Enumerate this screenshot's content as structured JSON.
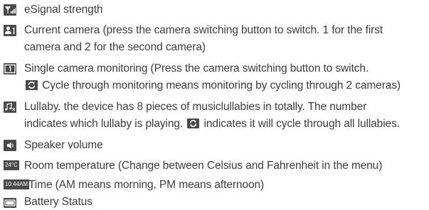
{
  "items": [
    {
      "icon": "signal-icon",
      "lines": [
        "eSignal strength"
      ]
    },
    {
      "icon": "camera-number-icon",
      "lines": [
        "Current camera (press the camera switching button to switch. 1 for the first",
        "camera and 2 for the second camera)"
      ]
    },
    {
      "icon": "single-monitor-icon",
      "lines": [
        "Single camera monitoring (Press the camera switching button to switch.",
        "Cycle through monitoring means monitoring by cycling through 2 cameras)"
      ]
    },
    {
      "icon": "lullaby-icon",
      "lines": [
        "Lullaby. the device has 8 pieces of musiclullabies in totally. The number",
        "indicates which lullaby is playing.",
        "indicates it will cycle through all lullabies."
      ]
    },
    {
      "icon": "speaker-icon",
      "lines": [
        "Speaker volume"
      ]
    },
    {
      "icon": "temperature-badge",
      "badge": "24°C",
      "lines": [
        "Room temperature (Change between Celsius and Fahrenheit in the menu)"
      ]
    },
    {
      "icon": "time-badge",
      "badge": "10:44AM",
      "lines": [
        "Time (AM means morning, PM means afternoon)"
      ]
    },
    {
      "icon": "battery-icon",
      "lines": [
        "Battery Status"
      ]
    }
  ]
}
